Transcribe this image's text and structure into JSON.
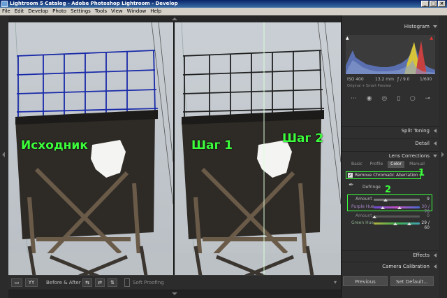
{
  "window": {
    "title": "Lightroom 5 Catalog - Adobe Photoshop Lightroom - Develop"
  },
  "menu": [
    "File",
    "Edit",
    "Develop",
    "Photo",
    "Settings",
    "Tools",
    "View",
    "Window",
    "Help"
  ],
  "captions": {
    "original": "Исходник",
    "step1": "Шаг 1",
    "step2": "Шаг 2"
  },
  "annotations": {
    "one": "1",
    "two": "2"
  },
  "toolbar": {
    "view_label": "YY",
    "before_after": "Before & After :",
    "soft_proofing": "Soft Proofing"
  },
  "histogram": {
    "title": "Histogram",
    "iso": "ISO 400",
    "focal": "13.2 mm",
    "aperture": "ƒ / 9.0",
    "shutter": "1/600",
    "preview": "Original + Smart Preview"
  },
  "panels": {
    "split_toning": "Split Toning",
    "detail": "Detail",
    "lens_corrections": "Lens Corrections",
    "effects": "Effects",
    "camera_calibration": "Camera Calibration"
  },
  "lens_tabs": [
    "Basic",
    "Profile",
    "Color",
    "Manual"
  ],
  "lens_active_tab": "Color",
  "remove_ca": {
    "label": "Remove Chromatic Aberration",
    "checked": true
  },
  "defringe": {
    "title": "Defringe",
    "amount1_label": "Amount",
    "amount1_value": "9",
    "purple_hue_label": "Purple Hue",
    "purple_hue_value": "30 / 70",
    "amount2_label": "Amount",
    "amount2_value": "0",
    "green_hue_label": "Green Hue",
    "green_hue_value": "29 / 60"
  },
  "buttons": {
    "previous": "Previous",
    "set_default": "Set Default..."
  },
  "colors": {
    "accent_green": "#3cff3c",
    "panel_bg": "#2f2f2f"
  }
}
